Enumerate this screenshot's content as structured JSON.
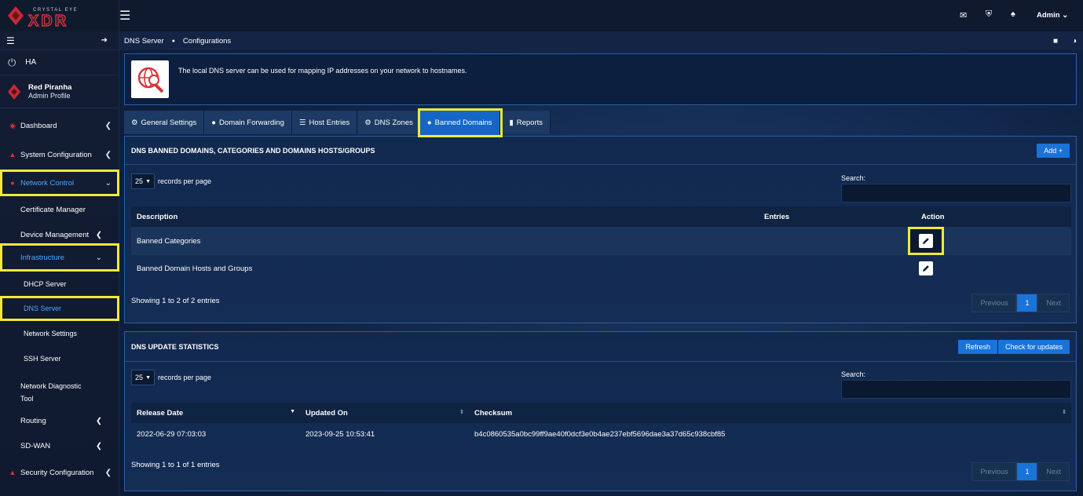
{
  "brand": {
    "tagline": "CRYSTAL EYE",
    "logo": "XDR"
  },
  "topbar": {
    "admin_label": "Admin"
  },
  "sidebar": {
    "ha_label": "HA",
    "profile": {
      "name": "Red Piranha",
      "role": "Admin Profile"
    },
    "items": [
      {
        "label": "Dashboard"
      },
      {
        "label": "System Configuration"
      },
      {
        "label": "Network Control"
      },
      {
        "label": "Certificate Manager"
      },
      {
        "label": "Device Management"
      },
      {
        "label": "Infrastructure"
      },
      {
        "label": "DHCP Server"
      },
      {
        "label": "DNS Server"
      },
      {
        "label": "Network Settings"
      },
      {
        "label": "SSH Server"
      },
      {
        "label": "Network Diagnostic"
      },
      {
        "label": "Tool"
      },
      {
        "label": "Routing"
      },
      {
        "label": "SD-WAN"
      },
      {
        "label": "Security Configuration"
      }
    ]
  },
  "breadcrumb": {
    "parent": "DNS Server",
    "current": "Configurations"
  },
  "info": {
    "text": "The local DNS server can be used for mapping IP addresses on your network to hostnames."
  },
  "tabs": [
    {
      "label": "General Settings"
    },
    {
      "label": "Domain Forwarding"
    },
    {
      "label": "Host Entries"
    },
    {
      "label": "DNS Zones"
    },
    {
      "label": "Banned Domains"
    },
    {
      "label": "Reports"
    }
  ],
  "banned_panel": {
    "title": "DNS BANNED DOMAINS, CATEGORIES AND DOMAINS HOSTS/GROUPS",
    "add_label": "Add",
    "records_value": "25",
    "records_label": "records per page",
    "search_label": "Search:",
    "columns": [
      "Description",
      "Entries",
      "Action"
    ],
    "rows": [
      {
        "description": "Banned Categories",
        "entries": ""
      },
      {
        "description": "Banned Domain Hosts and Groups",
        "entries": ""
      }
    ],
    "showing": "Showing 1 to 2 of 2 entries",
    "pager": {
      "prev": "Previous",
      "page": "1",
      "next": "Next"
    }
  },
  "update_panel": {
    "title": "DNS UPDATE STATISTICS",
    "refresh_label": "Refresh",
    "check_label": "Check for updates",
    "records_value": "25",
    "records_label": "records per page",
    "search_label": "Search:",
    "columns": [
      "Release Date",
      "Updated On",
      "Checksum"
    ],
    "rows": [
      {
        "release_date": "2022-06-29 07:03:03",
        "updated_on": "2023-09-25 10:53:41",
        "checksum": "b4c0860535a0bc99ff9ae40f0dcf3e0b4ae237ebf5696dae3a37d65c938cbf85"
      }
    ],
    "showing": "Showing 1 to 1 of 1 entries",
    "pager": {
      "prev": "Previous",
      "page": "1",
      "next": "Next"
    }
  },
  "colors": {
    "accent": "#1a73d9",
    "highlight": "#f0e93a",
    "brand_red": "#d6333b"
  }
}
